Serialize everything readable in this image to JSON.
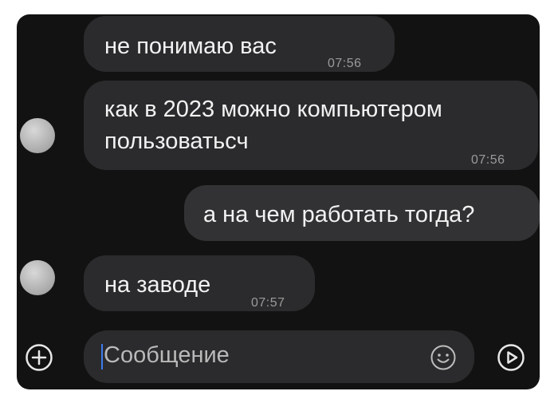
{
  "messages": [
    {
      "text": "не понимаю вас",
      "time": "07:56",
      "direction": "incoming"
    },
    {
      "text": "как в 2023 можно компьютером\nпользоватьсч",
      "time": "07:56",
      "direction": "incoming"
    },
    {
      "text": "а на чем работать тогда?",
      "direction": "outgoing"
    },
    {
      "text": "на заводе",
      "time": "07:57",
      "direction": "incoming"
    }
  ],
  "composer": {
    "placeholder": "Сообщение"
  },
  "icons": {
    "attach": "plus-circle-icon",
    "emoji": "smiley-icon",
    "send": "play-circle-icon"
  },
  "colors": {
    "background": "#121212",
    "bubble": "#2b2b2d",
    "caret": "#3d7bf0"
  }
}
